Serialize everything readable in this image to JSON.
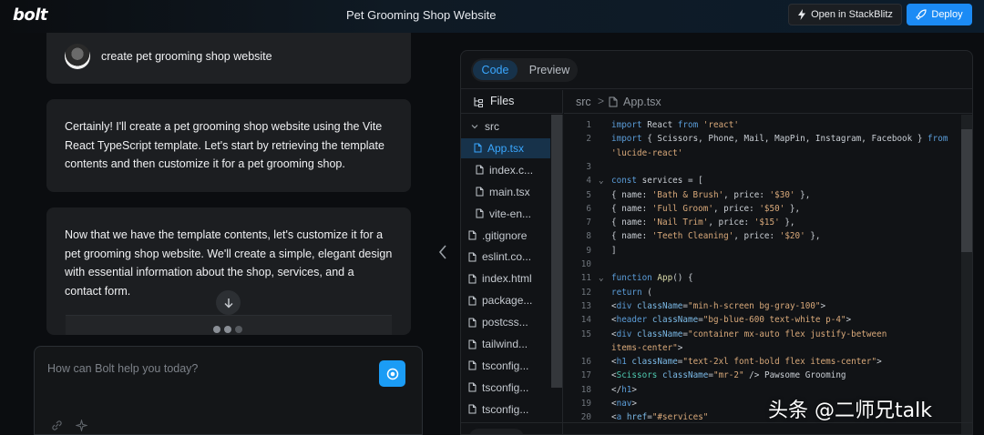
{
  "header": {
    "logo": "bolt",
    "project_title": "Pet Grooming Shop Website",
    "open_stackblitz_label": "Open in StackBlitz",
    "deploy_label": "Deploy",
    "icons": {
      "stackblitz": "lightning-icon",
      "deploy": "rocket-icon"
    }
  },
  "chat": {
    "user_message": "create pet grooming shop website",
    "assistant_messages": [
      {
        "text": "Certainly! I'll create a pet grooming shop website using the Vite React TypeScript template. Let's start by retrieving the template contents and then customize it for a pet grooming shop."
      },
      {
        "text": "Now that we have the template contents, let's customize it for a pet grooming shop website. We'll create a simple, elegant design with essential information about the shop, services, and a contact form."
      }
    ],
    "prompt_placeholder": "How can Bolt help you today?"
  },
  "workbench": {
    "tabs": [
      {
        "label": "Code",
        "active": true
      },
      {
        "label": "Preview",
        "active": false
      }
    ],
    "files_label": "Files",
    "tree": [
      {
        "label": "src",
        "type": "folder"
      },
      {
        "label": "App.tsx",
        "type": "file",
        "active": true
      },
      {
        "label": "index.c...",
        "type": "file"
      },
      {
        "label": "main.tsx",
        "type": "file"
      },
      {
        "label": "vite-en...",
        "type": "file"
      },
      {
        "label": ".gitignore",
        "type": "file"
      },
      {
        "label": "eslint.co...",
        "type": "file"
      },
      {
        "label": "index.html",
        "type": "file"
      },
      {
        "label": "package...",
        "type": "file"
      },
      {
        "label": "postcss...",
        "type": "file"
      },
      {
        "label": "tailwind...",
        "type": "file"
      },
      {
        "label": "tsconfig...",
        "type": "file"
      },
      {
        "label": "tsconfig...",
        "type": "file"
      },
      {
        "label": "tsconfig...",
        "type": "file"
      }
    ],
    "breadcrumb": {
      "folder": "src",
      "separator": ">",
      "file": "App.tsx"
    },
    "code_lines": [
      {
        "n": "1",
        "html": "<span class='kw'>import</span> React <span class='kw'>from</span> <span class='str'>'react'</span>"
      },
      {
        "n": "2",
        "html": "<span class='kw'>import</span> { Scissors, Phone, Mail, MapPin, Instagram, Facebook } <span class='kw'>from</span>"
      },
      {
        "n": "",
        "html": "<span class='str'>'lucide-react'</span>"
      },
      {
        "n": "3",
        "html": ""
      },
      {
        "n": "4",
        "fold": true,
        "html": "<span class='kw'>const</span> services = ["
      },
      {
        "n": "5",
        "html": "  { name: <span class='str'>'Bath &amp; Brush'</span>, price: <span class='str'>'$30'</span> },"
      },
      {
        "n": "6",
        "html": "  { name: <span class='str'>'Full Groom'</span>, price: <span class='str'>'$50'</span> },"
      },
      {
        "n": "7",
        "html": "  { name: <span class='str'>'Nail Trim'</span>, price: <span class='str'>'$15'</span> },"
      },
      {
        "n": "8",
        "html": "  { name: <span class='str'>'Teeth Cleaning'</span>, price: <span class='str'>'$20'</span> },"
      },
      {
        "n": "9",
        "html": "]"
      },
      {
        "n": "10",
        "html": ""
      },
      {
        "n": "11",
        "fold": true,
        "html": "<span class='kw'>function</span> <span class='fn'>App</span>() {"
      },
      {
        "n": "12",
        "html": "  <span class='kw'>return</span> ("
      },
      {
        "n": "13",
        "html": "    &lt;<span class='tag'>div</span> <span class='attr'>className</span>=<span class='str'>\"min-h-screen bg-gray-100\"</span>&gt;"
      },
      {
        "n": "14",
        "html": "      &lt;<span class='tag'>header</span> <span class='attr'>className</span>=<span class='str'>\"bg-blue-600 text-white p-4\"</span>&gt;"
      },
      {
        "n": "15",
        "html": "        &lt;<span class='tag'>div</span> <span class='attr'>className</span>=<span class='str'>\"container mx-auto flex justify-between</span>"
      },
      {
        "n": "",
        "html": "<span class='str'>items-center\"</span>&gt;"
      },
      {
        "n": "16",
        "html": "          &lt;<span class='tag'>h1</span> <span class='attr'>className</span>=<span class='str'>\"text-2xl font-bold flex items-center\"</span>&gt;"
      },
      {
        "n": "17",
        "html": "            &lt;<span class='cmp'>Scissors</span> <span class='attr'>className</span>=<span class='str'>\"mr-2\"</span> /&gt; Pawsome Grooming"
      },
      {
        "n": "18",
        "html": "          &lt;/<span class='tag'>h1</span>&gt;"
      },
      {
        "n": "19",
        "html": "          &lt;<span class='tag'>nav</span>&gt;"
      },
      {
        "n": "20",
        "html": "            &lt;<span class='tag'>a</span> <span class='attr'>href</span>=<span class='str'>\"#services\"</span>"
      }
    ]
  },
  "watermark": "头条 @二师兄talk"
}
